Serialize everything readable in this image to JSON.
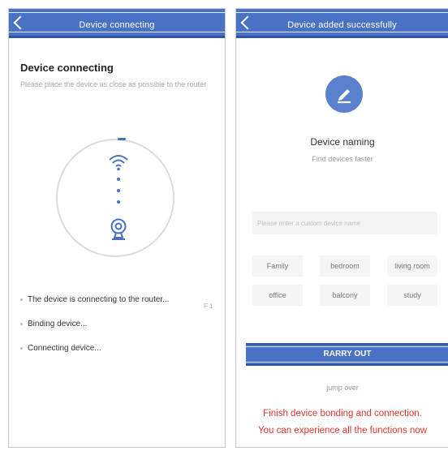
{
  "left_screen": {
    "header_title": "Device connecting",
    "heading": "Device connecting",
    "description": "Please place the device as close as possible to the router",
    "steps": [
      "The device is connecting to the router...",
      "Binding device...",
      "Connecting device..."
    ],
    "step_status": "F 1"
  },
  "right_screen": {
    "header_title": "Device added successfully",
    "naming_title": "Device naming",
    "naming_subtitle": "Find devices faster",
    "name_placeholder": "Please enter a custom device name",
    "rooms": [
      "Family",
      "bedroom",
      "living room",
      "office",
      "balcony",
      "study"
    ],
    "carry_out_label": "RARRY OUT",
    "jump_over_label": "jump over"
  },
  "caption": {
    "line1": "Finish device bonding and connection.",
    "line2": "You can experience all the functions now"
  },
  "colors": {
    "header_blue": "#4a72c4",
    "accent_red": "#e0332f"
  },
  "icons": {
    "back": "chevron-left-icon",
    "wifi": "wifi-icon",
    "camera": "camera-icon",
    "edit": "pencil-icon"
  }
}
